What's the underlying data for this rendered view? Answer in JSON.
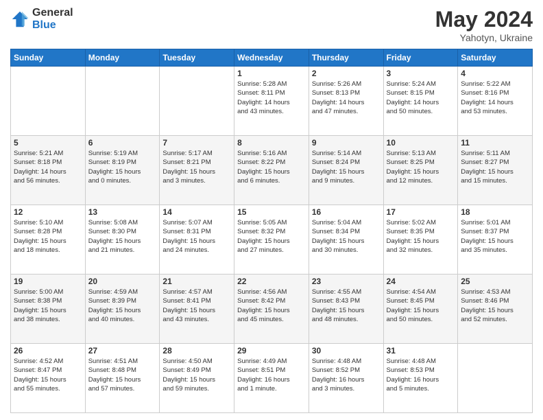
{
  "logo": {
    "general": "General",
    "blue": "Blue"
  },
  "header": {
    "title": "May 2024",
    "subtitle": "Yahotyn, Ukraine"
  },
  "weekdays": [
    "Sunday",
    "Monday",
    "Tuesday",
    "Wednesday",
    "Thursday",
    "Friday",
    "Saturday"
  ],
  "weeks": [
    [
      {
        "day": "",
        "info": ""
      },
      {
        "day": "",
        "info": ""
      },
      {
        "day": "",
        "info": ""
      },
      {
        "day": "1",
        "info": "Sunrise: 5:28 AM\nSunset: 8:11 PM\nDaylight: 14 hours\nand 43 minutes."
      },
      {
        "day": "2",
        "info": "Sunrise: 5:26 AM\nSunset: 8:13 PM\nDaylight: 14 hours\nand 47 minutes."
      },
      {
        "day": "3",
        "info": "Sunrise: 5:24 AM\nSunset: 8:15 PM\nDaylight: 14 hours\nand 50 minutes."
      },
      {
        "day": "4",
        "info": "Sunrise: 5:22 AM\nSunset: 8:16 PM\nDaylight: 14 hours\nand 53 minutes."
      }
    ],
    [
      {
        "day": "5",
        "info": "Sunrise: 5:21 AM\nSunset: 8:18 PM\nDaylight: 14 hours\nand 56 minutes."
      },
      {
        "day": "6",
        "info": "Sunrise: 5:19 AM\nSunset: 8:19 PM\nDaylight: 15 hours\nand 0 minutes."
      },
      {
        "day": "7",
        "info": "Sunrise: 5:17 AM\nSunset: 8:21 PM\nDaylight: 15 hours\nand 3 minutes."
      },
      {
        "day": "8",
        "info": "Sunrise: 5:16 AM\nSunset: 8:22 PM\nDaylight: 15 hours\nand 6 minutes."
      },
      {
        "day": "9",
        "info": "Sunrise: 5:14 AM\nSunset: 8:24 PM\nDaylight: 15 hours\nand 9 minutes."
      },
      {
        "day": "10",
        "info": "Sunrise: 5:13 AM\nSunset: 8:25 PM\nDaylight: 15 hours\nand 12 minutes."
      },
      {
        "day": "11",
        "info": "Sunrise: 5:11 AM\nSunset: 8:27 PM\nDaylight: 15 hours\nand 15 minutes."
      }
    ],
    [
      {
        "day": "12",
        "info": "Sunrise: 5:10 AM\nSunset: 8:28 PM\nDaylight: 15 hours\nand 18 minutes."
      },
      {
        "day": "13",
        "info": "Sunrise: 5:08 AM\nSunset: 8:30 PM\nDaylight: 15 hours\nand 21 minutes."
      },
      {
        "day": "14",
        "info": "Sunrise: 5:07 AM\nSunset: 8:31 PM\nDaylight: 15 hours\nand 24 minutes."
      },
      {
        "day": "15",
        "info": "Sunrise: 5:05 AM\nSunset: 8:32 PM\nDaylight: 15 hours\nand 27 minutes."
      },
      {
        "day": "16",
        "info": "Sunrise: 5:04 AM\nSunset: 8:34 PM\nDaylight: 15 hours\nand 30 minutes."
      },
      {
        "day": "17",
        "info": "Sunrise: 5:02 AM\nSunset: 8:35 PM\nDaylight: 15 hours\nand 32 minutes."
      },
      {
        "day": "18",
        "info": "Sunrise: 5:01 AM\nSunset: 8:37 PM\nDaylight: 15 hours\nand 35 minutes."
      }
    ],
    [
      {
        "day": "19",
        "info": "Sunrise: 5:00 AM\nSunset: 8:38 PM\nDaylight: 15 hours\nand 38 minutes."
      },
      {
        "day": "20",
        "info": "Sunrise: 4:59 AM\nSunset: 8:39 PM\nDaylight: 15 hours\nand 40 minutes."
      },
      {
        "day": "21",
        "info": "Sunrise: 4:57 AM\nSunset: 8:41 PM\nDaylight: 15 hours\nand 43 minutes."
      },
      {
        "day": "22",
        "info": "Sunrise: 4:56 AM\nSunset: 8:42 PM\nDaylight: 15 hours\nand 45 minutes."
      },
      {
        "day": "23",
        "info": "Sunrise: 4:55 AM\nSunset: 8:43 PM\nDaylight: 15 hours\nand 48 minutes."
      },
      {
        "day": "24",
        "info": "Sunrise: 4:54 AM\nSunset: 8:45 PM\nDaylight: 15 hours\nand 50 minutes."
      },
      {
        "day": "25",
        "info": "Sunrise: 4:53 AM\nSunset: 8:46 PM\nDaylight: 15 hours\nand 52 minutes."
      }
    ],
    [
      {
        "day": "26",
        "info": "Sunrise: 4:52 AM\nSunset: 8:47 PM\nDaylight: 15 hours\nand 55 minutes."
      },
      {
        "day": "27",
        "info": "Sunrise: 4:51 AM\nSunset: 8:48 PM\nDaylight: 15 hours\nand 57 minutes."
      },
      {
        "day": "28",
        "info": "Sunrise: 4:50 AM\nSunset: 8:49 PM\nDaylight: 15 hours\nand 59 minutes."
      },
      {
        "day": "29",
        "info": "Sunrise: 4:49 AM\nSunset: 8:51 PM\nDaylight: 16 hours\nand 1 minute."
      },
      {
        "day": "30",
        "info": "Sunrise: 4:48 AM\nSunset: 8:52 PM\nDaylight: 16 hours\nand 3 minutes."
      },
      {
        "day": "31",
        "info": "Sunrise: 4:48 AM\nSunset: 8:53 PM\nDaylight: 16 hours\nand 5 minutes."
      },
      {
        "day": "",
        "info": ""
      }
    ]
  ]
}
